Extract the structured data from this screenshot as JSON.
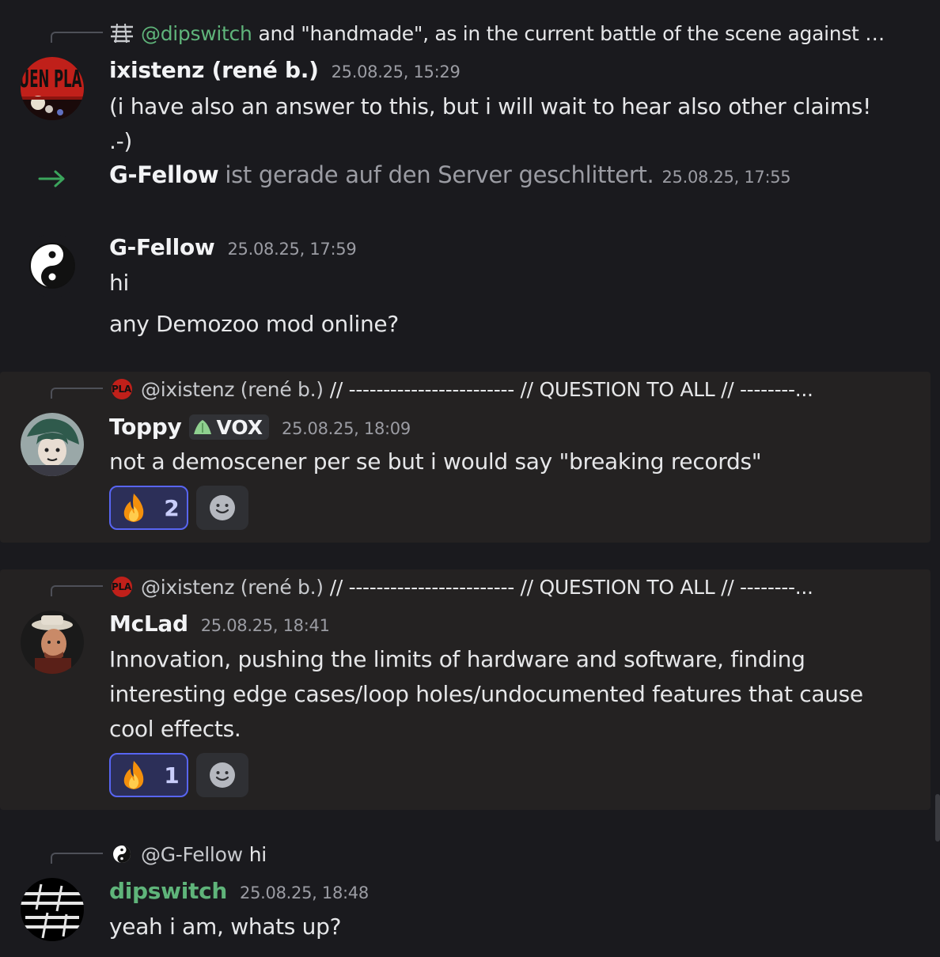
{
  "messages": [
    {
      "reply": {
        "mention": "@dipswitch",
        "snippet": "and \"handmade\", as in the current battle of the scene against AI s..."
      },
      "author": "ixistenz (rené b.)",
      "timestamp": "25.08.25, 15:29",
      "lines": [
        "(i have also an answer to this, but i will wait to hear also other claims! .-)"
      ]
    },
    {
      "join": {
        "name": "G-Fellow",
        "text": "ist gerade auf den Server geschlittert.",
        "timestamp": "25.08.25, 17:55"
      }
    },
    {
      "author": "G-Fellow",
      "timestamp": "25.08.25, 17:59",
      "lines": [
        "hi",
        "any Demozoo mod online?"
      ]
    },
    {
      "reply": {
        "mention": "@ixistenz (rené b.)",
        "snippet": "// ------------------------ // QUESTION TO ALL // --------..."
      },
      "author": "Toppy",
      "tag": "VOX",
      "timestamp": "25.08.25, 18:09",
      "lines": [
        "not a demoscener per se but i would say \"breaking records\""
      ],
      "reaction": {
        "emoji": "fire",
        "count": "2"
      }
    },
    {
      "reply": {
        "mention": "@ixistenz (rené b.)",
        "snippet": "// ------------------------ // QUESTION TO ALL // --------..."
      },
      "author": "McLad",
      "timestamp": "25.08.25, 18:41",
      "lines": [
        "Innovation, pushing the limits of hardware and software, finding",
        "interesting edge cases/loop holes/undocumented features that cause",
        "cool effects."
      ],
      "reaction": {
        "emoji": "fire",
        "count": "1"
      }
    },
    {
      "reply": {
        "mention": "@G-Fellow",
        "snippet": "hi"
      },
      "author": "dipswitch",
      "timestamp": "25.08.25, 18:48",
      "lines": [
        "yeah i am, whats up?"
      ]
    }
  ],
  "colors": {
    "background": "#1a1a1e",
    "highlight": "#242222",
    "green_name": "#5fb47a",
    "reaction_border": "#5865f2",
    "join_arrow": "#3ba55c"
  },
  "icons": [
    "reply-spine",
    "join-arrow-icon",
    "fire-emoji-icon",
    "add-reaction-icon",
    "yin-yang-icon"
  ]
}
